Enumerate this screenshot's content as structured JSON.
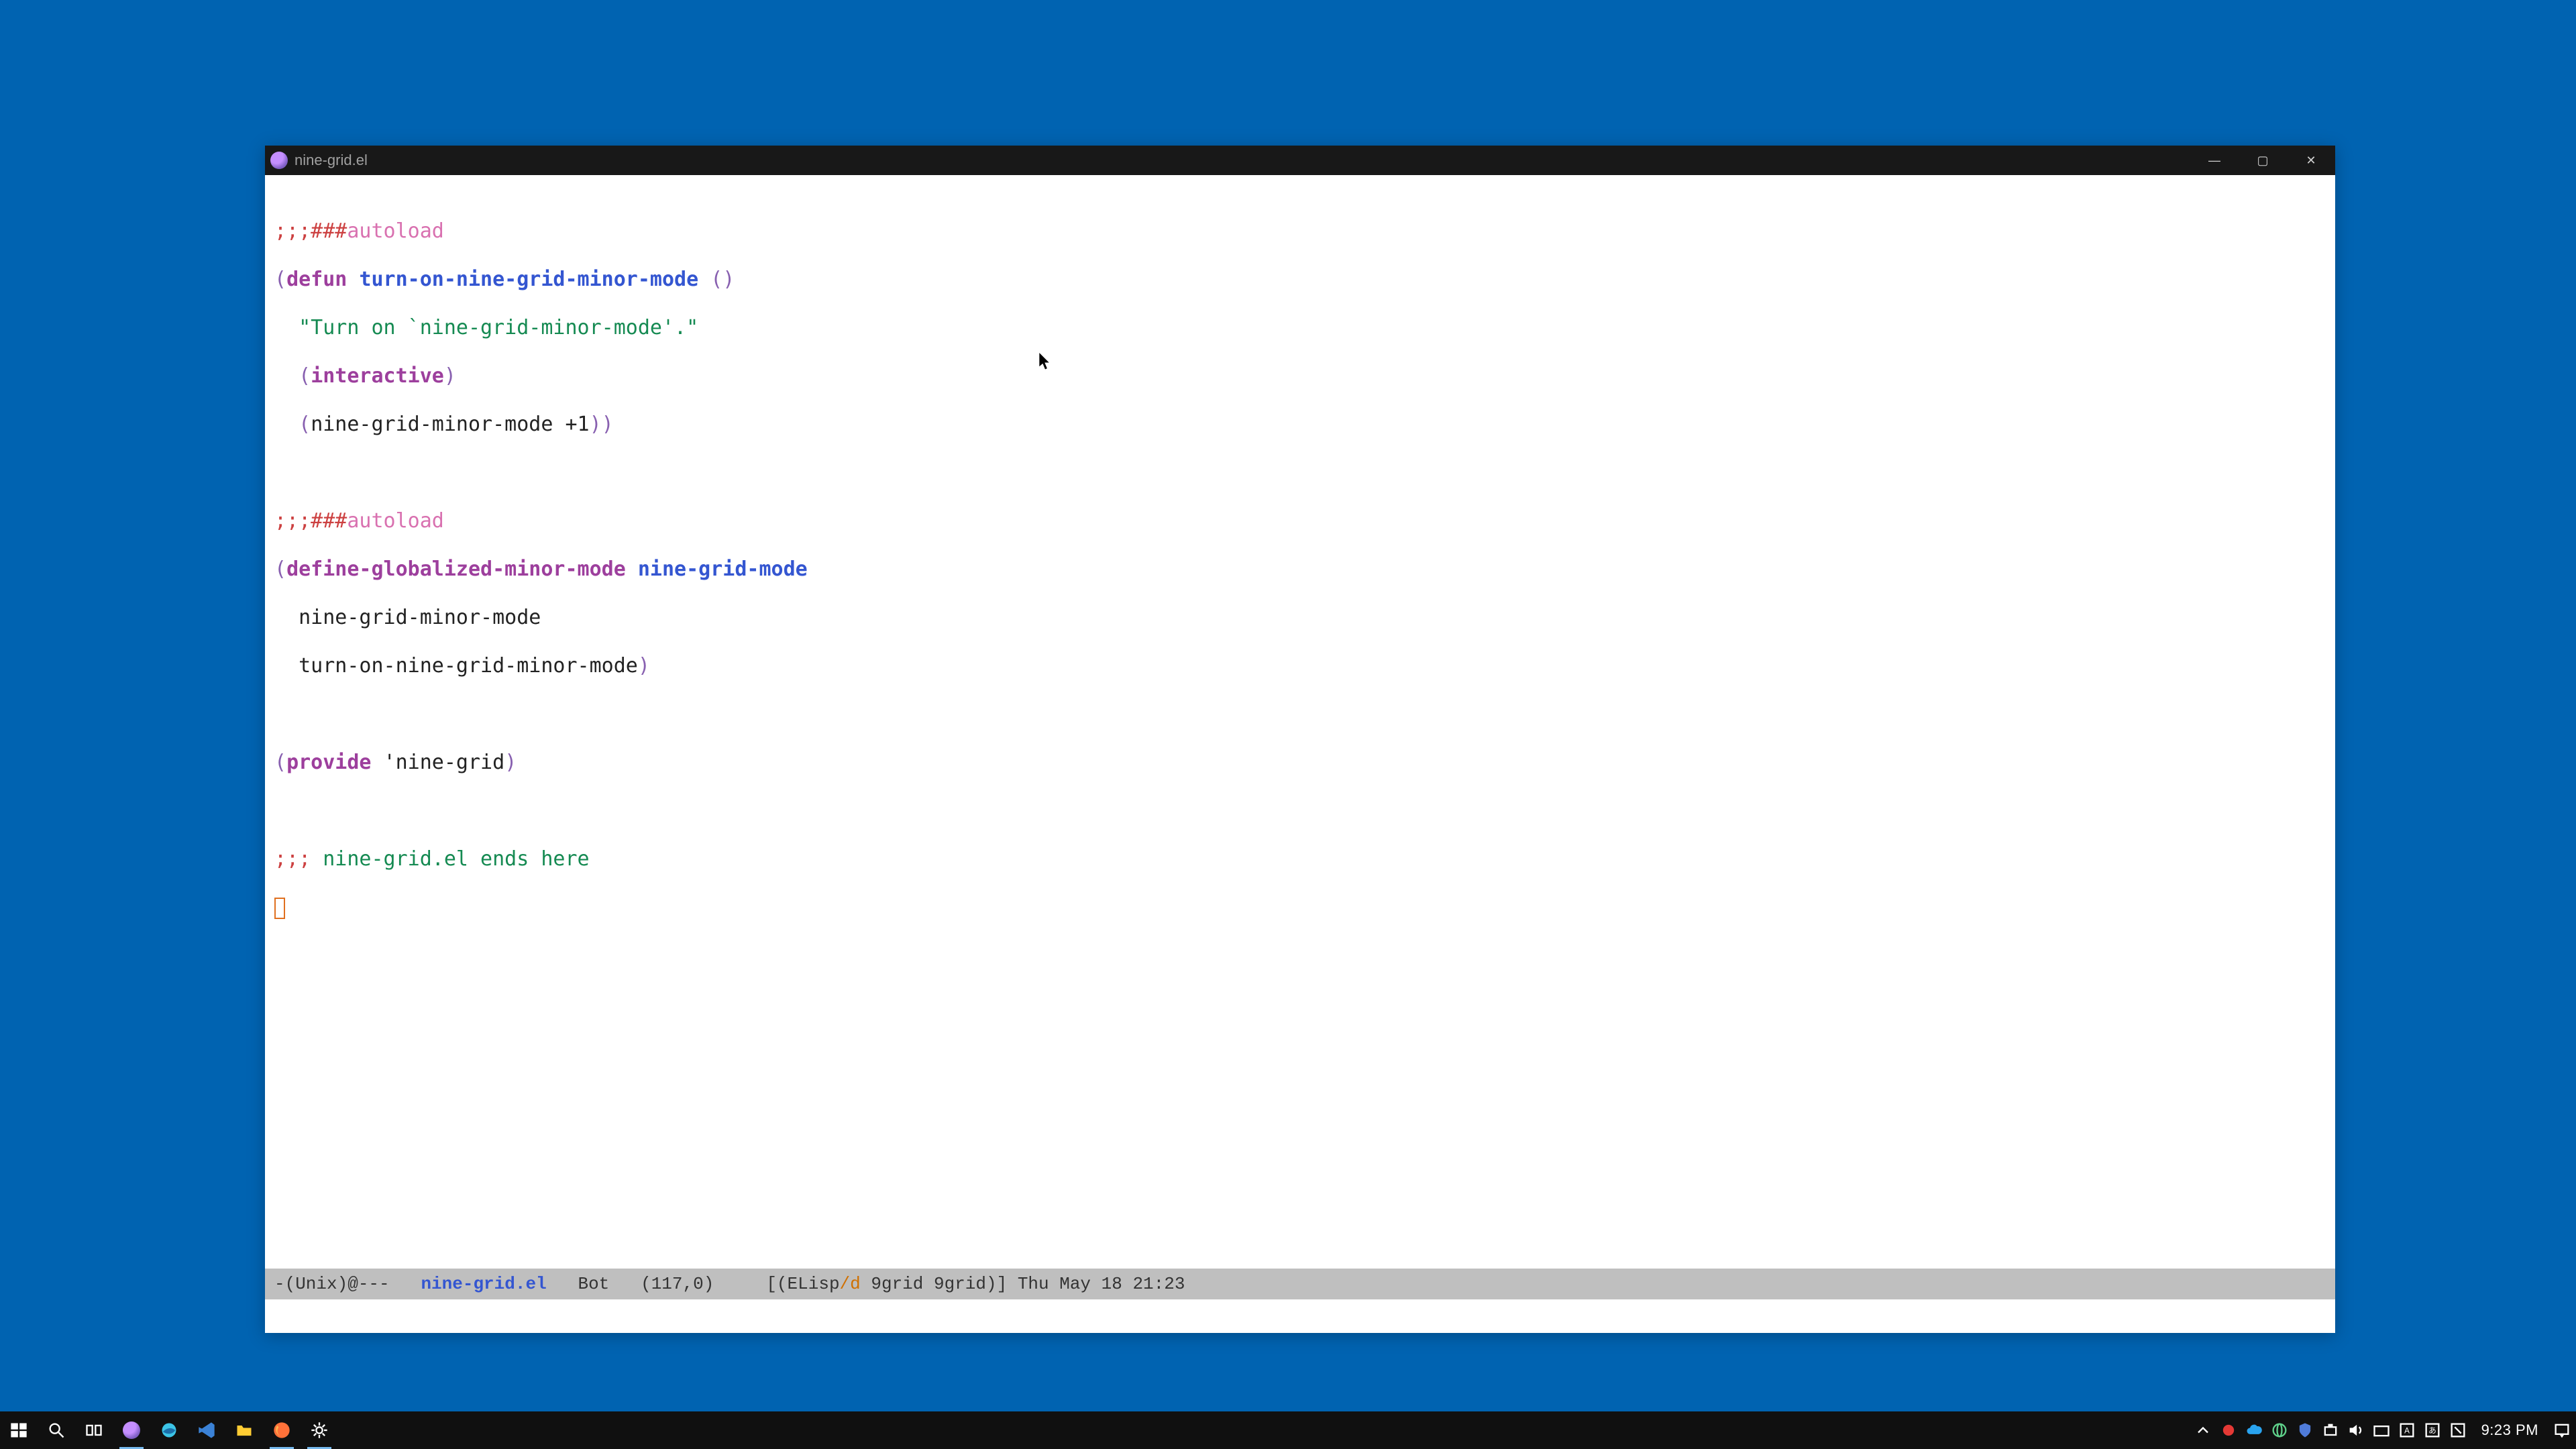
{
  "window": {
    "title": "nine-grid.el"
  },
  "win_controls": {
    "minimize": "—",
    "maximize": "▢",
    "close": "✕"
  },
  "code": {
    "l1_comment": ";;;###",
    "l1_auto": "autoload",
    "l2_defun": "defun",
    "l2_name": "turn-on-nine-grid-minor-mode",
    "l3_doc": "\"Turn on `nine-grid-minor-mode'.\"",
    "l4_interactive": "interactive",
    "l5_body": "nine-grid-minor-mode +1",
    "l7_comment": ";;;###",
    "l7_auto": "autoload",
    "l8_macro": "define-globalized-minor-mode",
    "l8_name": "nine-grid-mode",
    "l9": "nine-grid-minor-mode",
    "l10": "turn-on-nine-grid-minor-mode",
    "l12_provide": "provide",
    "l12_sym": "'nine-grid",
    "l14_a": ";;;",
    "l14_b": " nine-grid.el ends here"
  },
  "modeline": {
    "left": "-(Unix)@---   ",
    "bufname": "nine-grid.el",
    "mid1": "   Bot   (117,0)     [(ELisp",
    "warn": "/d",
    "mid2": " 9grid 9grid)] ",
    "datetime": "Thu May 18 21:23"
  },
  "taskbar": {
    "clock": "9:23 PM"
  }
}
